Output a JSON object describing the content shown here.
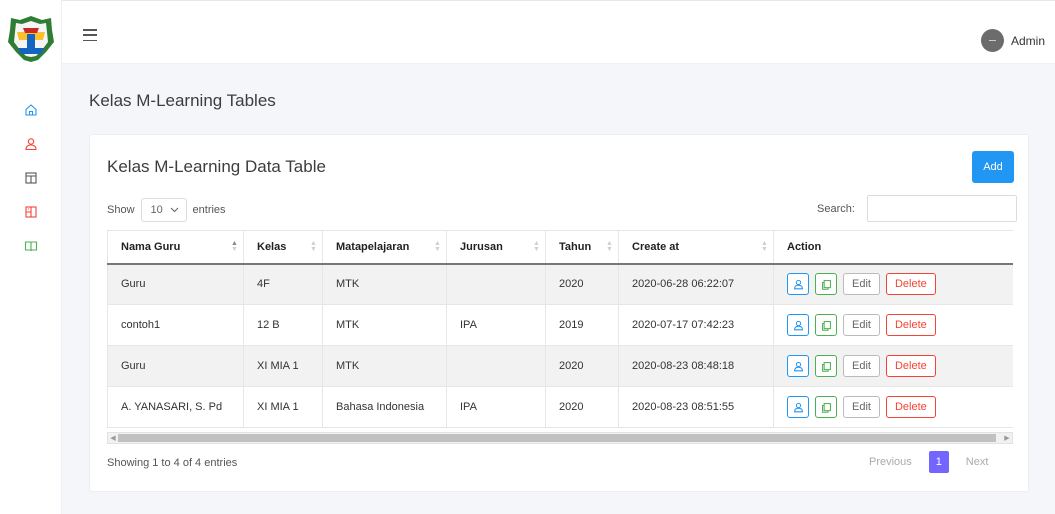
{
  "sidebar": {
    "items": [
      {
        "icon": "home-icon",
        "color": "#2196f3"
      },
      {
        "icon": "user-icon",
        "color": "#f44336"
      },
      {
        "icon": "layout-icon",
        "color": "#555555"
      },
      {
        "icon": "book-icon",
        "color": "#f44336"
      },
      {
        "icon": "open-book-icon",
        "color": "#4caf50"
      }
    ]
  },
  "header": {
    "user_name": "Admin"
  },
  "page": {
    "title": "Kelas M-Learning Tables"
  },
  "card": {
    "title": "Kelas M-Learning Data Table",
    "add_label": "Add",
    "length": {
      "show_label": "Show",
      "value": "10",
      "entries_label": "entries"
    },
    "search": {
      "label": "Search:",
      "value": "",
      "placeholder": ""
    },
    "columns": [
      "Nama Guru",
      "Kelas",
      "Matapelajaran",
      "Jurusan",
      "Tahun",
      "Create at",
      "Action"
    ],
    "rows": [
      {
        "nama_guru": "Guru",
        "kelas": "4F",
        "matapelajaran": "MTK",
        "jurusan": "",
        "tahun": "2020",
        "create_at": "2020-06-28 06:22:07"
      },
      {
        "nama_guru": "contoh1",
        "kelas": "12 B",
        "matapelajaran": "MTK",
        "jurusan": "IPA",
        "tahun": "2019",
        "create_at": "2020-07-17 07:42:23"
      },
      {
        "nama_guru": "Guru",
        "kelas": "XI MIA 1",
        "matapelajaran": "MTK",
        "jurusan": "",
        "tahun": "2020",
        "create_at": "2020-08-23 08:48:18"
      },
      {
        "nama_guru": "A. YANASARI, S. Pd",
        "kelas": "XI MIA 1",
        "matapelajaran": "Bahasa Indonesia",
        "jurusan": "IPA",
        "tahun": "2020",
        "create_at": "2020-08-23 08:51:55"
      }
    ],
    "action_labels": {
      "edit": "Edit",
      "delete": "Delete"
    },
    "info": "Showing 1 to 4 of 4 entries",
    "pagination": {
      "previous": "Previous",
      "current": "1",
      "next": "Next"
    }
  },
  "colors": {
    "primary": "#2196f3",
    "success": "#4caf50",
    "danger": "#f44336",
    "page_active": "#7366ff"
  }
}
